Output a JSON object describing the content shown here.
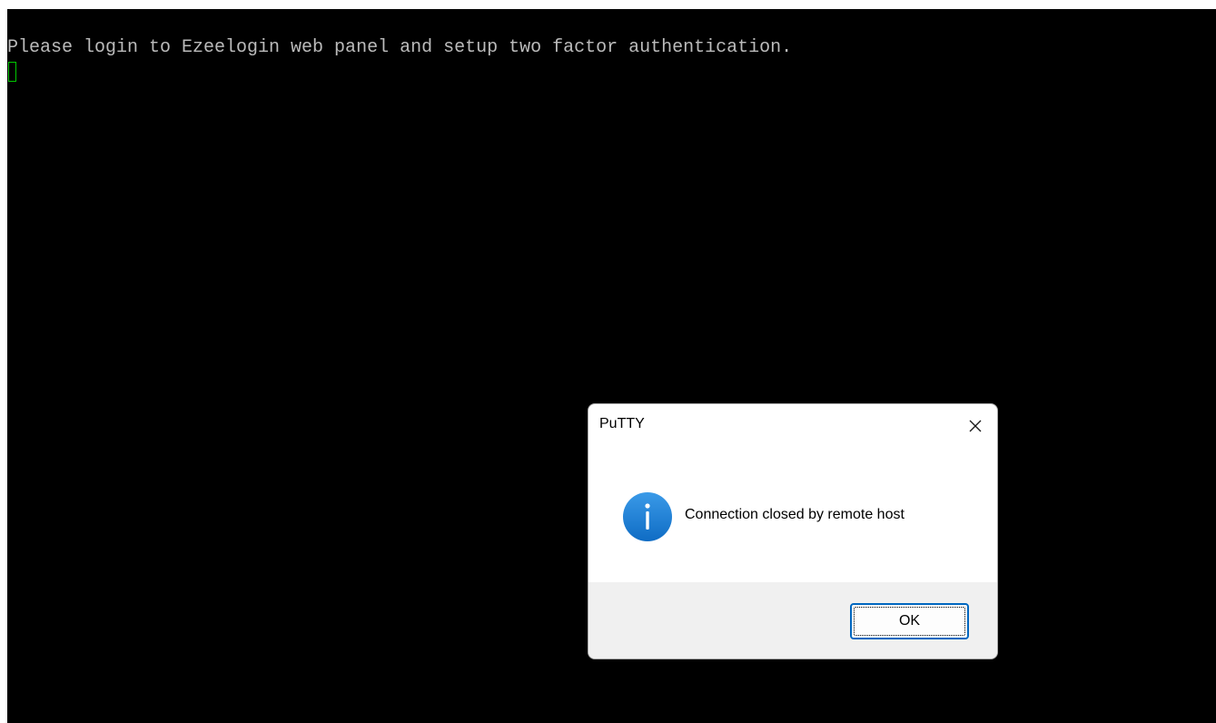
{
  "terminal": {
    "output_line": "Please login to Ezeelogin web panel and setup two factor authentication."
  },
  "dialog": {
    "title": "PuTTY",
    "message": "Connection closed by remote host",
    "icon": "info-icon",
    "ok_label": "OK",
    "close_icon": "close-icon"
  },
  "colors": {
    "terminal_bg": "#000000",
    "terminal_text": "#bbbbbb",
    "cursor": "#00c800",
    "info_icon": "#1a7fd4",
    "button_border": "#0067c0"
  }
}
